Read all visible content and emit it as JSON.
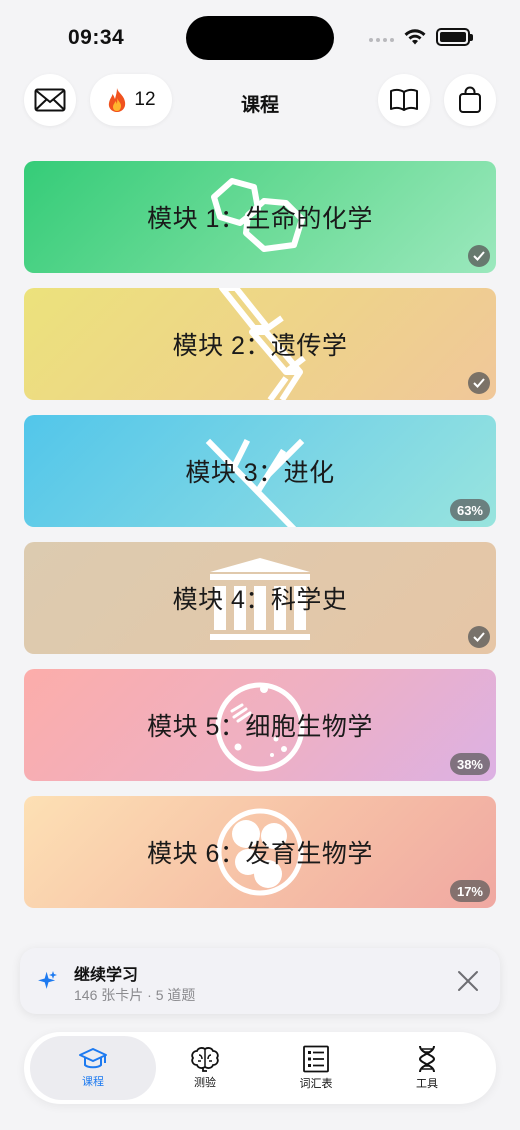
{
  "status_bar": {
    "time": "09:34"
  },
  "header": {
    "title": "课程",
    "streak_count": "12"
  },
  "modules": [
    {
      "label": "模块 1：生命的化学",
      "status": "complete",
      "icon": "chemistry-ring-icon"
    },
    {
      "label": "模块 2：遗传学",
      "status": "complete",
      "icon": "dna-icon"
    },
    {
      "label": "模块 3：进化",
      "status": "in-progress",
      "progress": "63%",
      "icon": "evolution-tree-icon"
    },
    {
      "label": "模块 4：科学史",
      "status": "complete",
      "icon": "museum-icon"
    },
    {
      "label": "模块 5：细胞生物学",
      "status": "in-progress",
      "progress": "38%",
      "icon": "cell-icon"
    },
    {
      "label": "模块 6：发育生物学",
      "status": "in-progress",
      "progress": "17%",
      "icon": "embryo-icon"
    }
  ],
  "continue_banner": {
    "title": "继续学习",
    "subtitle": "146 张卡片 · 5 道题"
  },
  "tabs": [
    {
      "label": "课程",
      "active": true,
      "icon": "graduation-cap-icon"
    },
    {
      "label": "测验",
      "active": false,
      "icon": "brain-icon"
    },
    {
      "label": "词汇表",
      "active": false,
      "icon": "glossary-list-icon"
    },
    {
      "label": "工具",
      "active": false,
      "icon": "dna-tool-icon"
    }
  ],
  "colors": {
    "accent": "#1d7af0",
    "background": "#f4f4f6"
  }
}
